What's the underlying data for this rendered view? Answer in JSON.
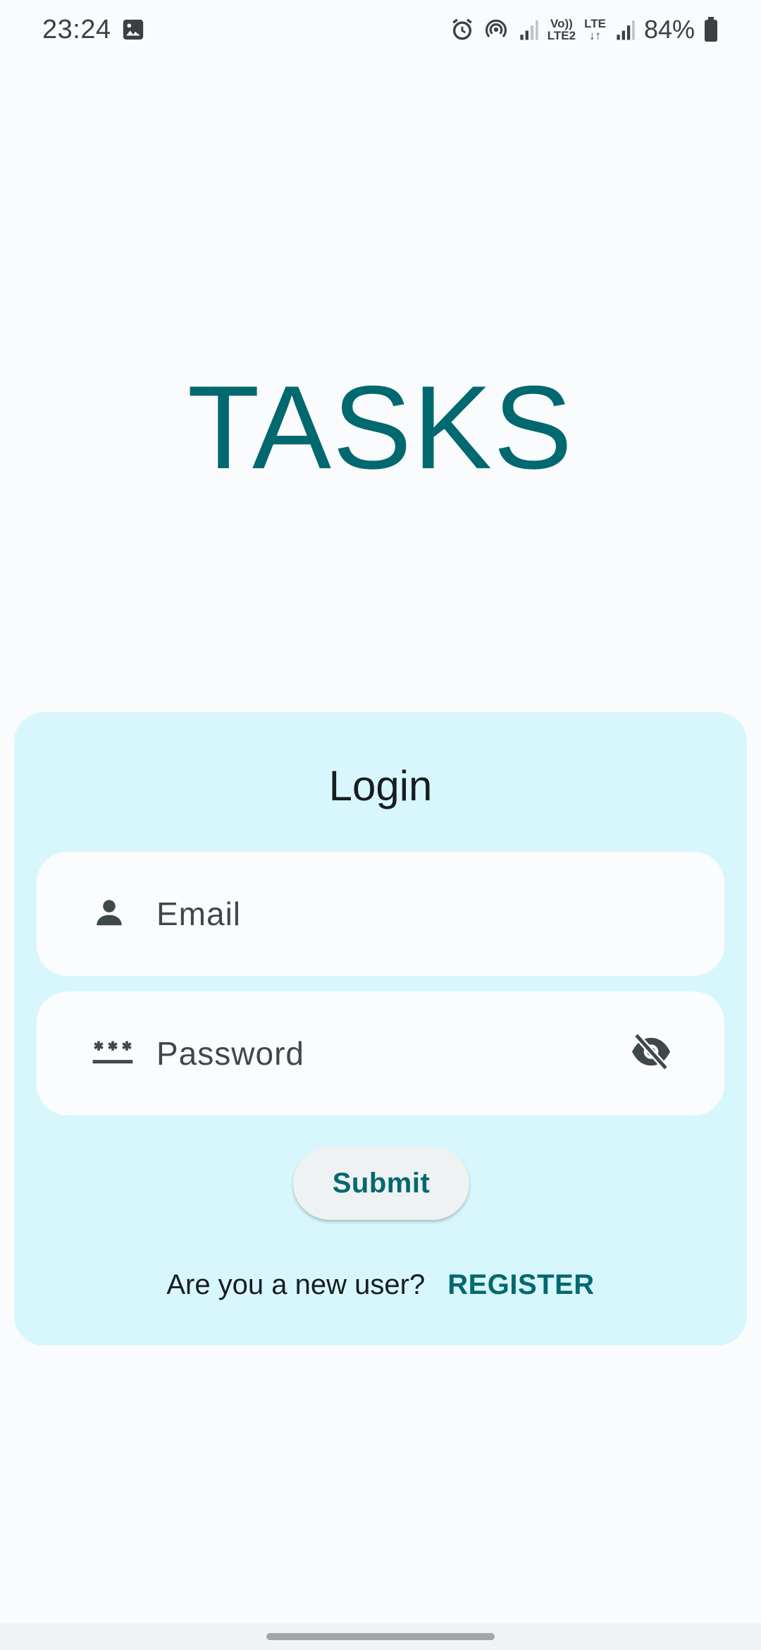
{
  "status_bar": {
    "time": "23:24",
    "volte_top": "Vo))",
    "volte_bottom": "LTE2",
    "lte_top": "LTE",
    "lte_bottom": "↓↑",
    "battery_percent": "84%",
    "icons": [
      "gallery-icon",
      "alarm-icon",
      "hotspot-icon",
      "signal-icon",
      "battery-icon"
    ]
  },
  "app": {
    "title": "TASKS",
    "accent_color": "#00696f",
    "card_color": "#d7f7fd"
  },
  "login": {
    "heading": "Login",
    "email_placeholder": "Email",
    "password_placeholder": "Password",
    "submit_label": "Submit",
    "register_question": "Are you a new user?",
    "register_link": "REGISTER"
  }
}
